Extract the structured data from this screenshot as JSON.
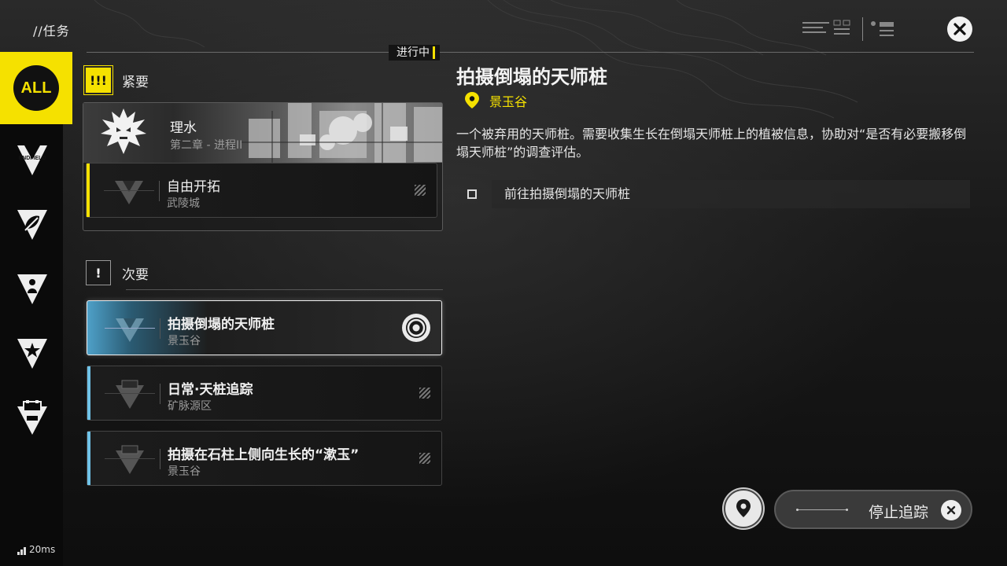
{
  "header": {
    "title": "//任务",
    "in_progress_label": "进行中"
  },
  "sidebar": {
    "items": [
      {
        "label": "ALL",
        "icon": "all-badge-icon",
        "active": true
      },
      {
        "label": "ENDFIELD",
        "icon": "endfield-icon",
        "active": false
      },
      {
        "label": "",
        "icon": "leaf-icon",
        "active": false
      },
      {
        "label": "",
        "icon": "person-icon",
        "active": false
      },
      {
        "label": "",
        "icon": "star-icon",
        "active": false
      },
      {
        "label": "",
        "icon": "box-icon",
        "active": false
      }
    ],
    "ping": "20ms"
  },
  "urgent_section": {
    "label": "紧要",
    "badge": "!!!",
    "chapter": {
      "title": "理水",
      "subtitle": "第二章 - 进程II"
    },
    "tasks": [
      {
        "title": "自由开拓",
        "location": "武陵城",
        "stripe": "#f5e100"
      }
    ]
  },
  "minor_section": {
    "label": "次要",
    "badge": "!",
    "tasks": [
      {
        "title": "拍摄倒塌的天师桩",
        "location": "景玉谷",
        "stripe": "#6fc3e8",
        "selected": true
      },
      {
        "title": "日常·天桩追踪",
        "location": "矿脉源区",
        "stripe": "#6fc3e8",
        "selected": false
      },
      {
        "title": "拍摄在石柱上侧向生长的“漱玉”",
        "location": "景玉谷",
        "stripe": "#6fc3e8",
        "selected": false
      }
    ]
  },
  "detail": {
    "title": "拍摄倒塌的天师桩",
    "location": "景玉谷",
    "description": "一个被弃用的天师桩。需要收集生长在倒塌天师桩上的植被信息，协助对“是否有必要搬移倒塌天师桩”的调查评估。",
    "objectives": [
      {
        "text": "前往拍摄倒塌的天师桩",
        "done": false
      }
    ]
  },
  "footer": {
    "stop_tracking_label": "停止追踪"
  },
  "colors": {
    "accent": "#f5e100",
    "minor_stripe": "#6fc3e8"
  }
}
